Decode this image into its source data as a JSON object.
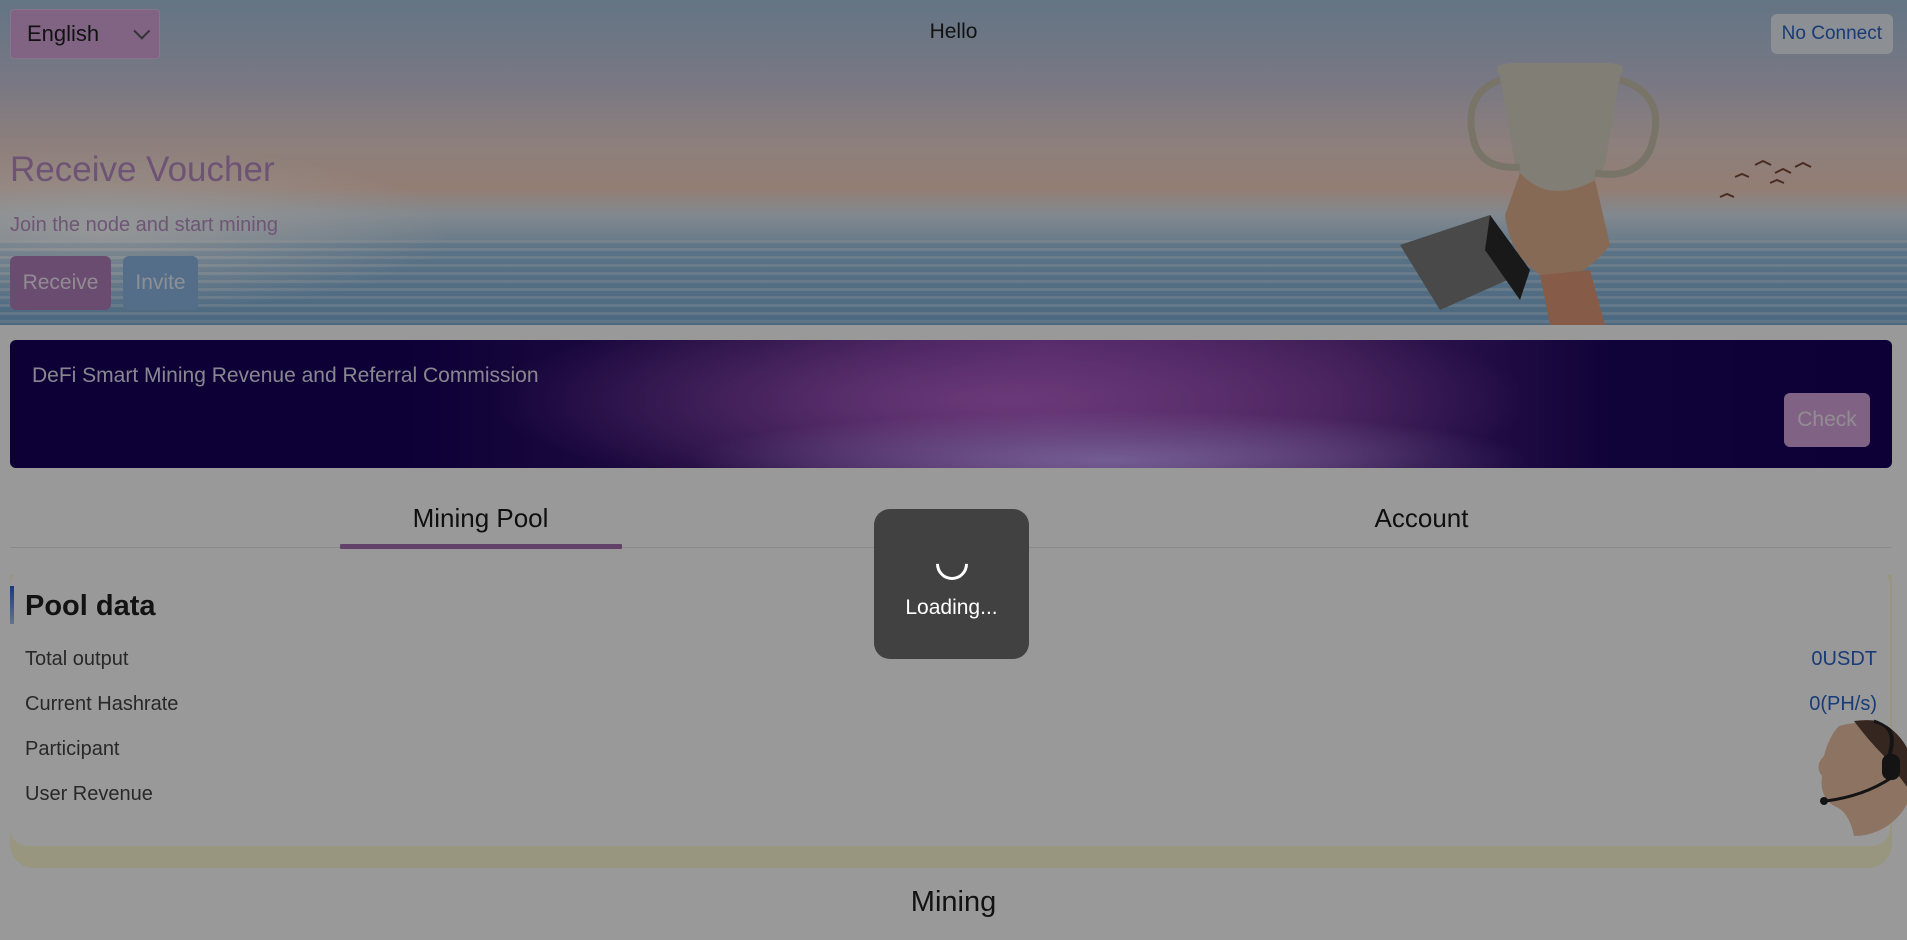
{
  "header": {
    "language": "English",
    "title": "Hello",
    "wallet_status": "No Connect"
  },
  "hero": {
    "title": "Receive Voucher",
    "subtitle": "Join the node and start mining",
    "receive_label": "Receive",
    "invite_label": "Invite"
  },
  "banner": {
    "text": "DeFi Smart Mining Revenue and Referral Commission",
    "check_label": "Check"
  },
  "tabs": [
    {
      "label": "Mining Pool",
      "active": true
    },
    {
      "label": "Account",
      "active": false
    }
  ],
  "pool": {
    "title": "Pool data",
    "rows": [
      {
        "label": "Total output",
        "value": "0USDT"
      },
      {
        "label": "Current Hashrate",
        "value": "0(PH/s)"
      },
      {
        "label": "Participant",
        "value": ""
      },
      {
        "label": "User Revenue",
        "value": ""
      }
    ]
  },
  "mining": {
    "title": "Mining"
  },
  "loading": {
    "text": "Loading..."
  },
  "colors": {
    "accent_purple": "#a66fb0",
    "link_blue": "#2b63c9",
    "invite_blue": "#8db6e3"
  },
  "icons": {
    "language_chevron": "chevron-down-icon",
    "spinner": "loading-spinner-icon",
    "support": "customer-support-icon"
  }
}
